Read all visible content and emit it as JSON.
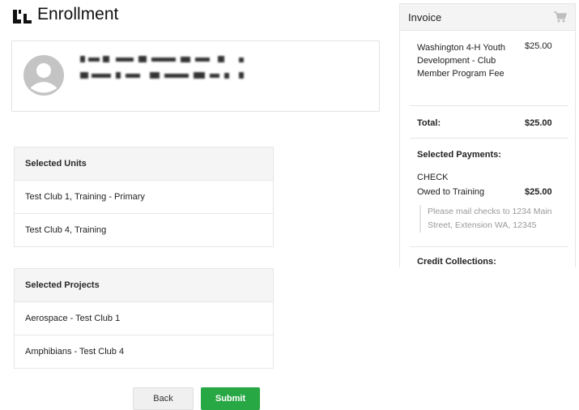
{
  "header": {
    "title": "Enrollment"
  },
  "units": {
    "heading": "Selected Units",
    "items": [
      "Test Club 1, Training - Primary",
      "Test Club 4, Training"
    ]
  },
  "projects": {
    "heading": "Selected Projects",
    "items": [
      "Aerospace - Test Club 1",
      "Amphibians - Test Club 4"
    ]
  },
  "buttons": {
    "back": "Back",
    "submit": "Submit"
  },
  "invoice": {
    "title": "Invoice",
    "item_desc": "Washington 4-H Youth Development - Club Member Program Fee",
    "item_amount": "$25.00",
    "total_label": "Total:",
    "total_amount": "$25.00",
    "payments_heading": "Selected Payments:",
    "payment_method": "CHECK",
    "owed_label": "Owed to Training",
    "owed_amount": "$25.00",
    "check_note": "Please mail checks to 1234 Main Street, Extension WA, 12345",
    "credit_heading": "Credit Collections:"
  },
  "colors": {
    "submit": "#28a745",
    "avatar": "#c4c4c4",
    "panel_header": "#f5f5f5"
  },
  "icons": {
    "logo": "brand-logo-icon",
    "avatar": "user-avatar-icon",
    "cart": "cart-icon"
  }
}
